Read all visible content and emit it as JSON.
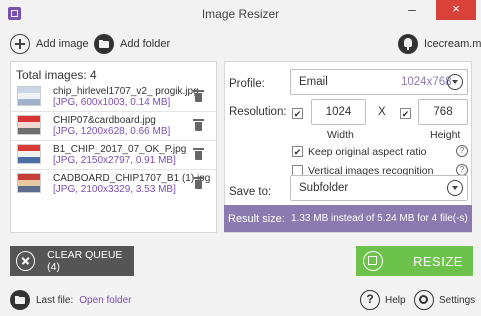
{
  "window": {
    "title": "Image Resizer",
    "minimize": "–",
    "close": "×"
  },
  "toolbar": {
    "add_image": "Add image",
    "add_folder": "Add folder",
    "brand": "Icecream.me"
  },
  "files": {
    "total_label": "Total images: 4",
    "items": [
      {
        "name": "chip_hirlevel1707_v2_ progik.jpg",
        "meta": "[JPG, 600x1003, 0.14 MB]",
        "colors": [
          "#c9d7e8",
          "#eef2f6",
          "#9fb3cc"
        ]
      },
      {
        "name": "CHIP07&cardboard.jpg",
        "meta": "[JPG, 1200x628, 0.66 MB]",
        "colors": [
          "#d93434",
          "#f2d8d0",
          "#6d6d6d"
        ]
      },
      {
        "name": "B1_CHIP_2017_07_OK_P.jpg",
        "meta": "[JPG, 2150x2797, 0.91 MB]",
        "colors": [
          "#d93a34",
          "#f0f0f0",
          "#4a6fa5"
        ]
      },
      {
        "name": "CADBOARD_CHIP1707_B1 (1).jpg",
        "meta": "[JPG, 2100x3329, 3.53 MB]",
        "colors": [
          "#c93d39",
          "#e8c9a0",
          "#5b6b8c"
        ]
      }
    ]
  },
  "settings": {
    "profile_label": "Profile:",
    "profile_value": "Email",
    "profile_size": "1024x768",
    "resolution_label": "Resolution:",
    "width_value": "1024",
    "height_value": "768",
    "x_sep": "X",
    "width_label": "Width",
    "height_label": "Height",
    "check_mark": "✔",
    "keep_aspect_label": "Keep original aspect ratio",
    "vertical_label": "Vertical images recognition",
    "help_glyph": "?",
    "save_to_label": "Save to:",
    "save_to_value": "Subfolder"
  },
  "result": {
    "label": "Result size:",
    "value": "1.33 MB instead of 5.24 MB for 4 file(-s)"
  },
  "actions": {
    "clear_queue": "CLEAR QUEUE (4)",
    "resize": "RESIZE"
  },
  "footer": {
    "last_file_label": "Last file:",
    "open_folder": "Open folder",
    "help": "Help",
    "help_glyph": "?",
    "settings": "Settings"
  },
  "colors": {
    "accent_purple": "#7a4fb4",
    "resize_green": "#6cc24a",
    "result_bar": "#8a7ab0",
    "close_red": "#d9423b"
  }
}
